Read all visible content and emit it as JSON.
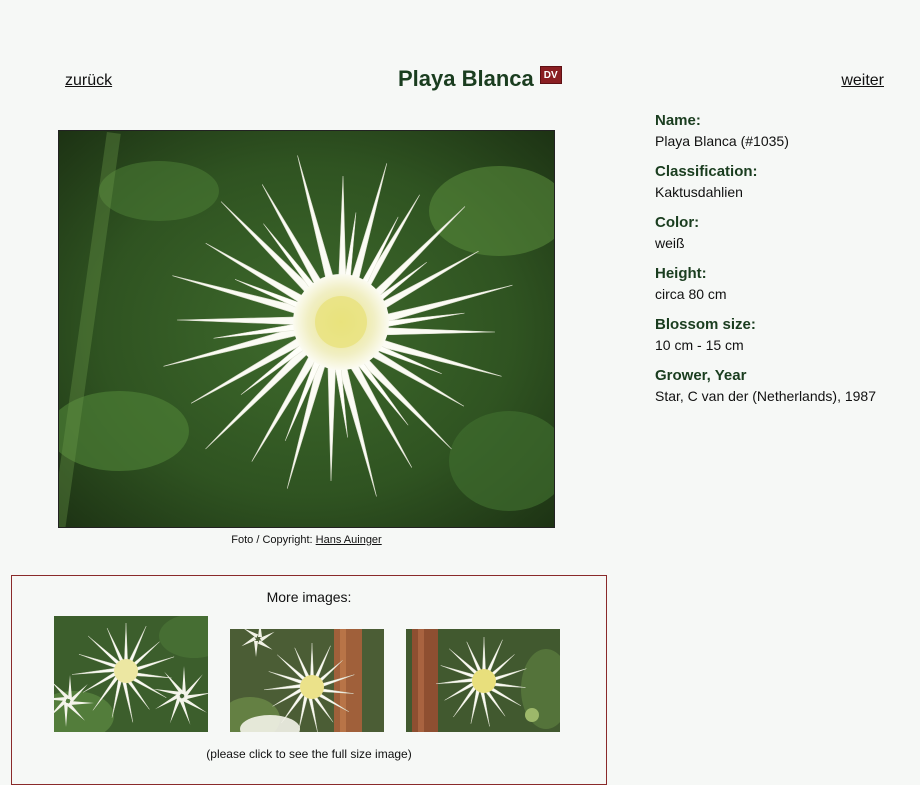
{
  "nav": {
    "back_label": "zurück",
    "next_label": "weiter"
  },
  "header": {
    "title": "Playa Blanca",
    "badge": "DV"
  },
  "photo": {
    "caption_prefix": "Foto / Copyright:",
    "photographer": "Hans Auinger"
  },
  "info": {
    "name_label": "Name:",
    "name_value": "Playa Blanca (#1035)",
    "classification_label": "Classification:",
    "classification_value": "Kaktusdahlien",
    "color_label": "Color:",
    "color_value": "weiß",
    "height_label": "Height:",
    "height_value": "circa 80 cm",
    "blossom_label": "Blossom size:",
    "blossom_value": "10 cm - 15 cm",
    "grower_label": "Grower, Year",
    "grower_value": "Star, C van der (Netherlands), 1987"
  },
  "more_images": {
    "title": "More images:",
    "note": "(please click to see the full size image)"
  },
  "colors": {
    "heading_green": "#1a3d1f",
    "badge_red": "#8a1e22",
    "box_border": "#8a2a2a",
    "background": "#f6f8f6"
  }
}
